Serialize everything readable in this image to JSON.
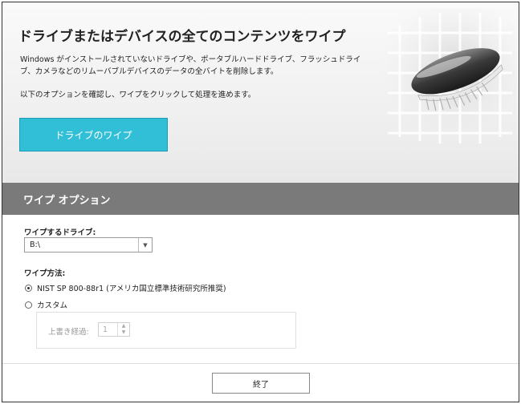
{
  "hero": {
    "title": "ドライブまたはデバイスの全てのコンテンツをワイプ",
    "description": "Windows がインストールされていないドライブや、ポータブルハードドライブ、フラッシュドライブ、カメラなどのリムーバブルデバイスのデータの全バイトを削除します。",
    "note": "以下のオプションを確認し、ワイプをクリックして処理を進めます。",
    "wipe_button_label": "ドライブのワイプ",
    "art_icon": "brush-eraser-icon"
  },
  "options": {
    "section_title": "ワイプ オプション",
    "drive_label": "ワイプするドライブ:",
    "drive_selected": "B:\\",
    "method_label": "ワイプ方法:",
    "method_nist": "NIST SP 800-88r1 (アメリカ国立標準技術研究所推奨)",
    "method_custom": "カスタム",
    "pass_label": "上書き経過:",
    "pass_value": "1"
  },
  "footer": {
    "close_label": "終了"
  },
  "colors": {
    "accent": "#30bfd6",
    "section_bar": "#7a7a7a"
  }
}
